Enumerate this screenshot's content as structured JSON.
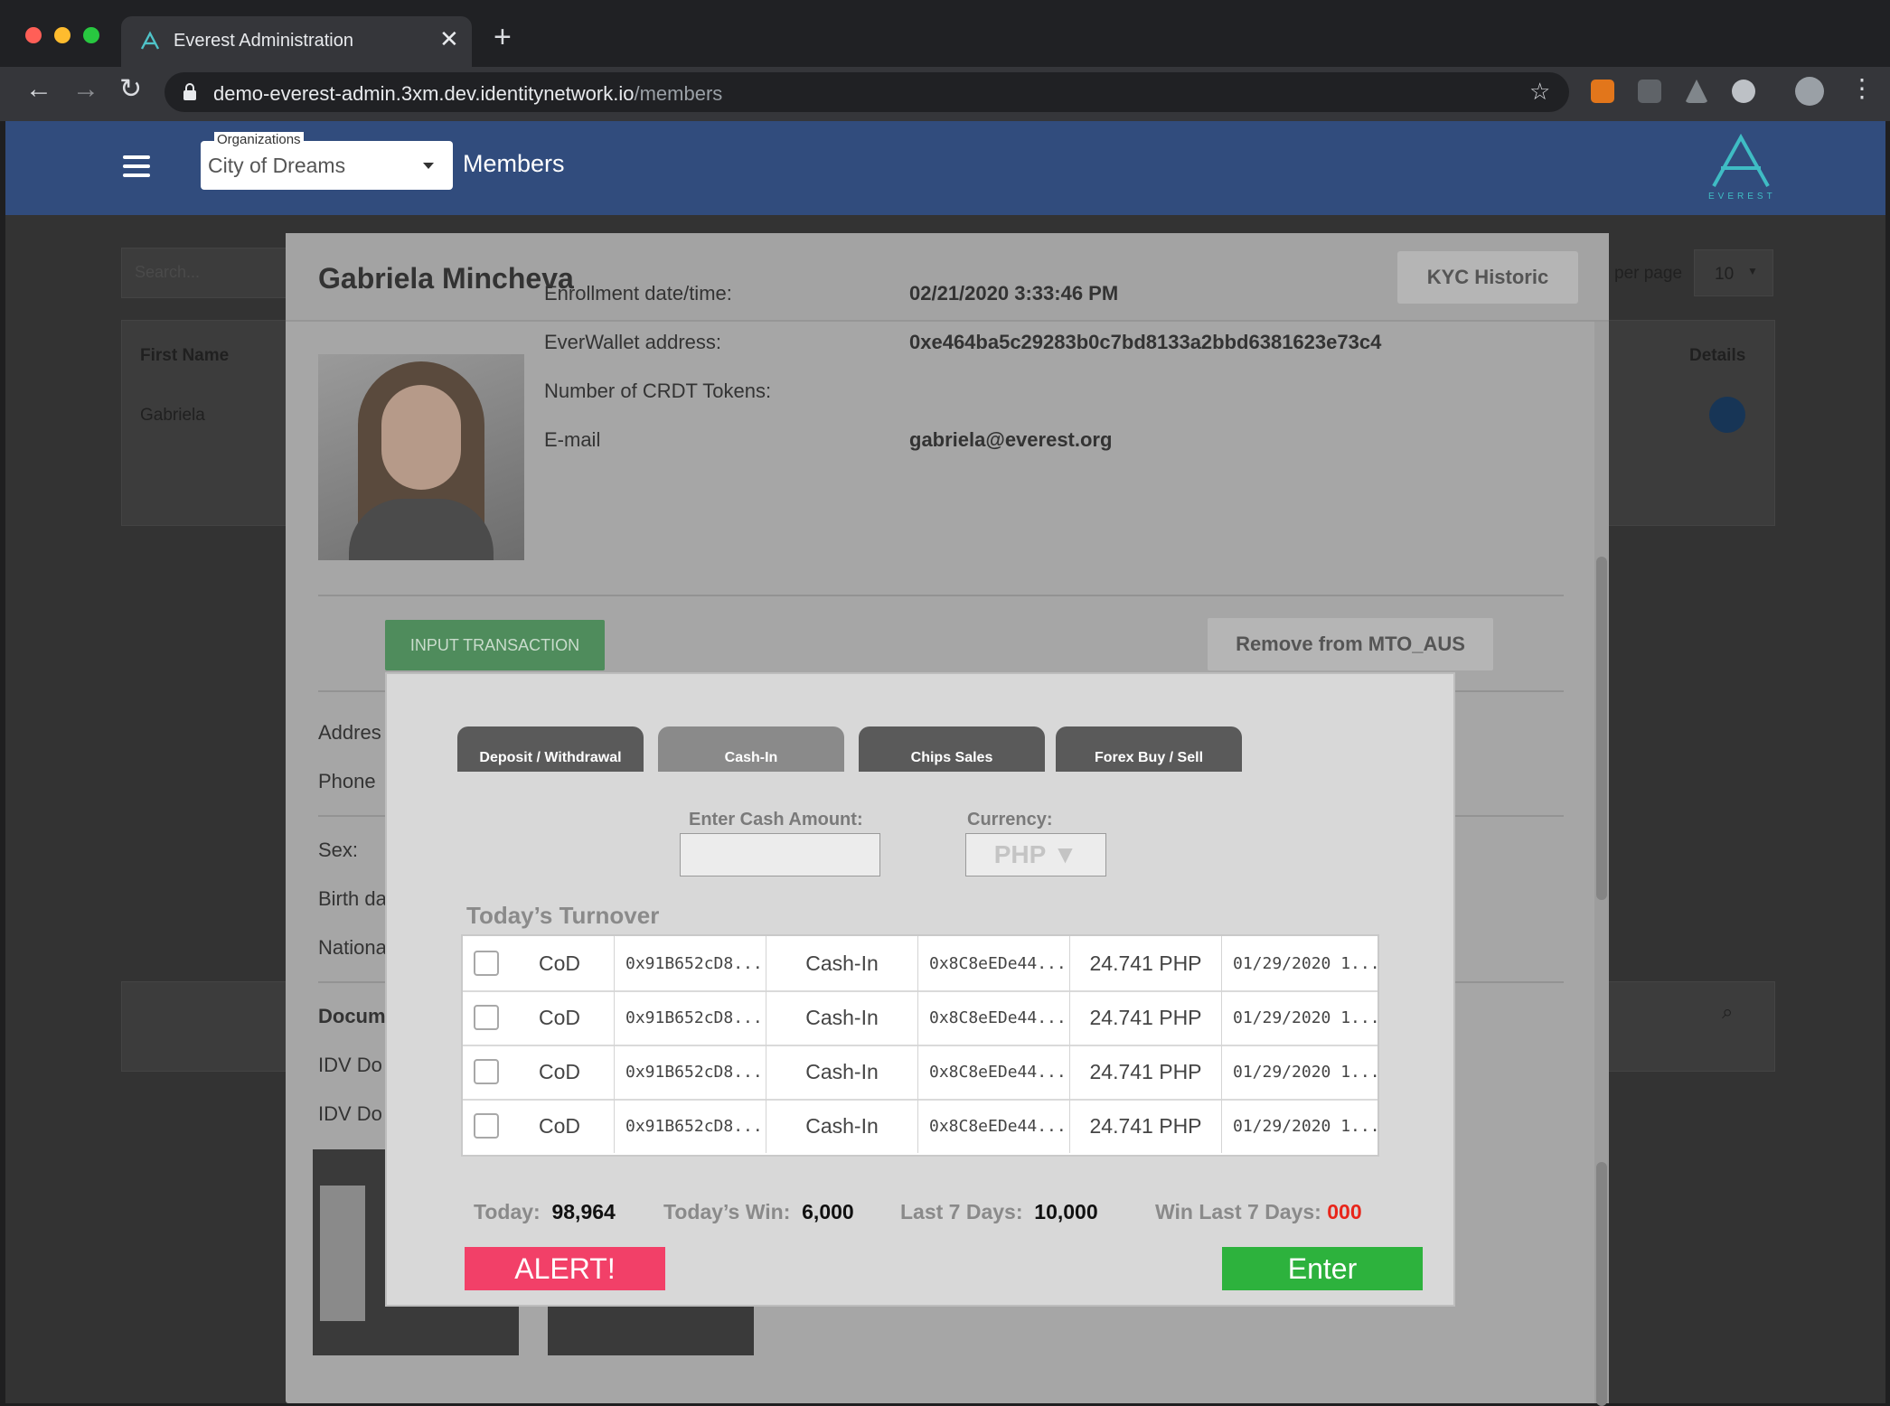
{
  "browser": {
    "tab_title": "Everest Administration",
    "url_host": "demo-everest-admin.3xm.dev.identitynetwork.io",
    "url_path": "/members"
  },
  "header": {
    "org_label": "Organizations",
    "org_value": "City of Dreams",
    "page_title": "Members",
    "logo_text": "EVEREST"
  },
  "background_page": {
    "search_placeholder": "Search...",
    "per_page_label": "per page",
    "per_page_value": "10",
    "col_first_name": "First Name",
    "col_details": "Details",
    "row_first_name": "Gabriela"
  },
  "member": {
    "name": "Gabriela Mincheva",
    "kyc_button": "KYC Historic",
    "fields": [
      {
        "label": "Enrollment date/time:",
        "value": "02/21/2020 3:33:46 PM"
      },
      {
        "label": "EverWallet address:",
        "value": "0xe464ba5c29283b0c7bd8133a2bbd6381623e73c4"
      },
      {
        "label": "Number of CRDT Tokens:",
        "value": ""
      },
      {
        "label": "E-mail",
        "value": "gabriela@everest.org"
      }
    ],
    "input_transaction_button": "INPUT TRANSACTION",
    "remove_button": "Remove from MTO_AUS",
    "side_labels": [
      "Addres",
      "Phone",
      "Sex:",
      "Birth da",
      "Nationa",
      "Docum",
      "IDV Do",
      "IDV Do"
    ]
  },
  "transaction": {
    "tabs": [
      {
        "label": "Deposit / Withdrawal",
        "active": false
      },
      {
        "label": "Cash-In",
        "active": true
      },
      {
        "label": "Chips Sales",
        "active": false
      },
      {
        "label": "Forex Buy / Sell",
        "active": false
      }
    ],
    "amount_label": "Enter Cash Amount:",
    "amount_value": "",
    "currency_label": "Currency:",
    "currency_value": "PHP ▼",
    "turnover_title": "Today’s Turnover",
    "rows": [
      {
        "org": "CoD",
        "from": "0x91B652cD8...",
        "type": "Cash-In",
        "to": "0x8C8eEDe44...",
        "amount": "24.741 PHP",
        "date": "01/29/2020 1..."
      },
      {
        "org": "CoD",
        "from": "0x91B652cD8...",
        "type": "Cash-In",
        "to": "0x8C8eEDe44...",
        "amount": "24.741 PHP",
        "date": "01/29/2020 1..."
      },
      {
        "org": "CoD",
        "from": "0x91B652cD8...",
        "type": "Cash-In",
        "to": "0x8C8eEDe44...",
        "amount": "24.741 PHP",
        "date": "01/29/2020 1..."
      },
      {
        "org": "CoD",
        "from": "0x91B652cD8...",
        "type": "Cash-In",
        "to": "0x8C8eEDe44...",
        "amount": "24.741 PHP",
        "date": "01/29/2020 1..."
      }
    ],
    "stats": {
      "today_label": "Today:",
      "today_value": "98,964",
      "win_label": "Today’s Win:",
      "win_value": "6,000",
      "last7_label": "Last 7 Days:",
      "last7_value": "10,000",
      "winlast7_label": "Win Last 7 Days:",
      "winlast7_value": "000"
    },
    "alert_button": "ALERT!",
    "enter_button": "Enter"
  },
  "colors": {
    "app_header": "#314c7d",
    "alert": "#f24068",
    "enter": "#2db23d",
    "input_tx": "#4f8c5c",
    "win_last7": "#e8251a"
  }
}
